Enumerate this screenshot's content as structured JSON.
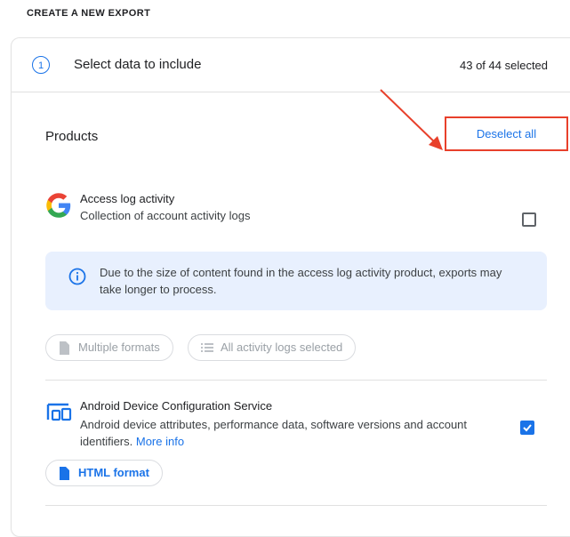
{
  "page": {
    "heading": "CREATE A NEW EXPORT"
  },
  "step": {
    "number": "1",
    "title": "Select data to include",
    "count": "43 of 44 selected"
  },
  "products": {
    "label": "Products",
    "deselect_all": "Deselect all",
    "items": [
      {
        "name": "Access log activity",
        "description": "Collection of account activity logs",
        "checked": false,
        "icon": "google-g-icon",
        "info": "Due to the size of content found in the access log activity product, exports may take longer to process.",
        "chips": [
          {
            "label": "Multiple formats",
            "icon": "file-icon"
          },
          {
            "label": "All activity logs selected",
            "icon": "list-icon"
          }
        ]
      },
      {
        "name": "Android Device Configuration Service",
        "description": "Android device attributes, performance data, software versions and account identifiers.",
        "more_info": "More info",
        "checked": true,
        "icon": "devices-icon",
        "chips": [
          {
            "label": "HTML format",
            "icon": "file-icon"
          }
        ]
      }
    ]
  },
  "colors": {
    "accent": "#1a73e8",
    "highlight": "#e8402b",
    "info_bg": "#e8f0fe"
  }
}
